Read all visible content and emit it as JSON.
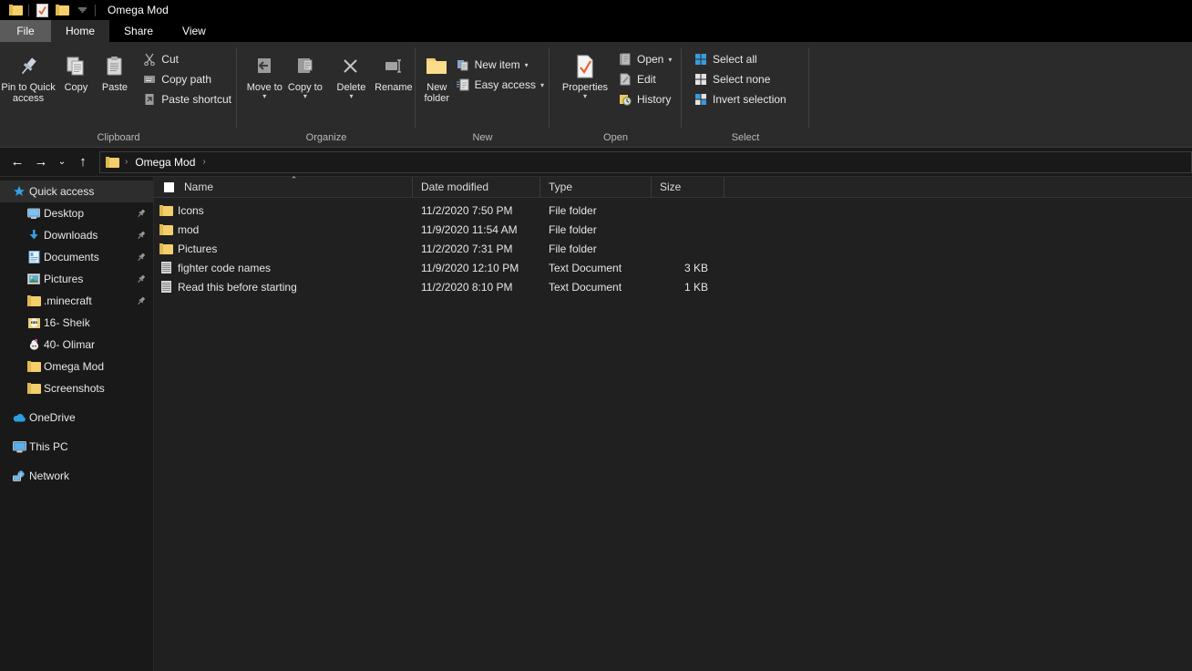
{
  "window": {
    "title": "Omega Mod",
    "quick_access_toolbar": [
      {
        "name": "folder-properties-icon",
        "glyph": "folder"
      },
      {
        "name": "properties-icon",
        "glyph": "properties"
      },
      {
        "name": "new-folder-icon",
        "glyph": "folder"
      },
      {
        "name": "customize-dropdown-icon",
        "glyph": "caret"
      }
    ]
  },
  "ribbon": {
    "tabs": [
      {
        "label": "File",
        "id": "file"
      },
      {
        "label": "Home",
        "id": "home"
      },
      {
        "label": "Share",
        "id": "share"
      },
      {
        "label": "View",
        "id": "view"
      }
    ],
    "active_tab": "Home",
    "groups": [
      {
        "label": "Clipboard",
        "big_buttons": [
          {
            "label": "Pin to Quick access",
            "icon": "pin-icon"
          },
          {
            "label": "Copy",
            "icon": "copy-icon"
          },
          {
            "label": "Paste",
            "icon": "paste-icon"
          }
        ],
        "small_buttons": [
          {
            "label": "Cut",
            "icon": "scissors-icon"
          },
          {
            "label": "Copy path",
            "icon": "copy-path-icon"
          },
          {
            "label": "Paste shortcut",
            "icon": "paste-shortcut-icon"
          }
        ]
      },
      {
        "label": "Organize",
        "big_buttons": [
          {
            "label": "Move to",
            "icon": "move-to-icon",
            "caret": true
          },
          {
            "label": "Copy to",
            "icon": "copy-to-icon",
            "caret": true
          },
          {
            "label": "Delete",
            "icon": "delete-icon",
            "caret": true
          },
          {
            "label": "Rename",
            "icon": "rename-icon"
          }
        ],
        "small_buttons": []
      },
      {
        "label": "New",
        "big_buttons": [
          {
            "label": "New folder",
            "icon": "new-folder-icon"
          }
        ],
        "small_buttons": [
          {
            "label": "New item",
            "icon": "new-item-icon",
            "caret": true
          },
          {
            "label": "Easy access",
            "icon": "easy-access-icon",
            "caret": true
          }
        ]
      },
      {
        "label": "Open",
        "big_buttons": [
          {
            "label": "Properties",
            "icon": "properties-icon",
            "caret": true
          }
        ],
        "small_buttons": [
          {
            "label": "Open",
            "icon": "open-icon",
            "caret": true
          },
          {
            "label": "Edit",
            "icon": "edit-icon"
          },
          {
            "label": "History",
            "icon": "history-icon"
          }
        ]
      },
      {
        "label": "Select",
        "big_buttons": [],
        "small_buttons": [
          {
            "label": "Select all",
            "icon": "select-all-icon"
          },
          {
            "label": "Select none",
            "icon": "select-none-icon"
          },
          {
            "label": "Invert selection",
            "icon": "invert-selection-icon"
          }
        ]
      }
    ]
  },
  "address_bar": {
    "back": "back-arrow-icon",
    "forward": "forward-arrow-icon",
    "recent": "recent-locations-icon",
    "up": "up-arrow-icon",
    "breadcrumb": [
      "Omega Mod"
    ]
  },
  "sidebar": {
    "items": [
      {
        "label": "Quick access",
        "icon": "star-icon",
        "level": 0,
        "selected": true,
        "pinned": false
      },
      {
        "label": "Desktop",
        "icon": "desktop-icon",
        "level": 1,
        "selected": false,
        "pinned": true
      },
      {
        "label": "Downloads",
        "icon": "downloads-icon",
        "level": 1,
        "selected": false,
        "pinned": true
      },
      {
        "label": "Documents",
        "icon": "documents-icon",
        "level": 1,
        "selected": false,
        "pinned": true
      },
      {
        "label": "Pictures",
        "icon": "pictures-icon",
        "level": 1,
        "selected": false,
        "pinned": true
      },
      {
        "label": ".minecraft",
        "icon": "folder-icon",
        "level": 1,
        "selected": false,
        "pinned": true
      },
      {
        "label": "16- Sheik",
        "icon": "folder-thumb-sheik-icon",
        "level": 1,
        "selected": false,
        "pinned": false
      },
      {
        "label": "40- Olimar",
        "icon": "folder-thumb-olimar-icon",
        "level": 1,
        "selected": false,
        "pinned": false
      },
      {
        "label": "Omega Mod",
        "icon": "folder-icon",
        "level": 1,
        "selected": false,
        "pinned": false
      },
      {
        "label": "Screenshots",
        "icon": "folder-icon",
        "level": 1,
        "selected": false,
        "pinned": false
      },
      {
        "label": "OneDrive",
        "icon": "onedrive-icon",
        "level": 0,
        "selected": false,
        "pinned": false,
        "gap_before": true
      },
      {
        "label": "This PC",
        "icon": "this-pc-icon",
        "level": 0,
        "selected": false,
        "pinned": false,
        "gap_before": true
      },
      {
        "label": "Network",
        "icon": "network-icon",
        "level": 0,
        "selected": false,
        "pinned": false,
        "gap_before": true
      }
    ]
  },
  "file_list": {
    "columns": [
      {
        "label": "Name",
        "sorted": "asc"
      },
      {
        "label": "Date modified",
        "sorted": ""
      },
      {
        "label": "Type",
        "sorted": ""
      },
      {
        "label": "Size",
        "sorted": ""
      }
    ],
    "rows": [
      {
        "name": "Icons",
        "date": "11/2/2020 7:50 PM",
        "type": "File folder",
        "size": "",
        "icon": "folder-icon"
      },
      {
        "name": "mod",
        "date": "11/9/2020 11:54 AM",
        "type": "File folder",
        "size": "",
        "icon": "folder-icon"
      },
      {
        "name": "Pictures",
        "date": "11/2/2020 7:31 PM",
        "type": "File folder",
        "size": "",
        "icon": "folder-icon"
      },
      {
        "name": "fighter code names",
        "date": "11/9/2020 12:10 PM",
        "type": "Text Document",
        "size": "3 KB",
        "icon": "text-document-icon"
      },
      {
        "name": "Read this before starting",
        "date": "11/2/2020 8:10 PM",
        "type": "Text Document",
        "size": "1 KB",
        "icon": "text-document-icon"
      }
    ]
  },
  "colors": {
    "window_bg": "#000000",
    "ribbon_bg": "#2b2b2b",
    "list_bg": "#202020",
    "sidebar_bg": "#191919",
    "accent_folder": "#f5cf6b",
    "text": "#e8e8e8",
    "selection": "#2d2d2d"
  }
}
